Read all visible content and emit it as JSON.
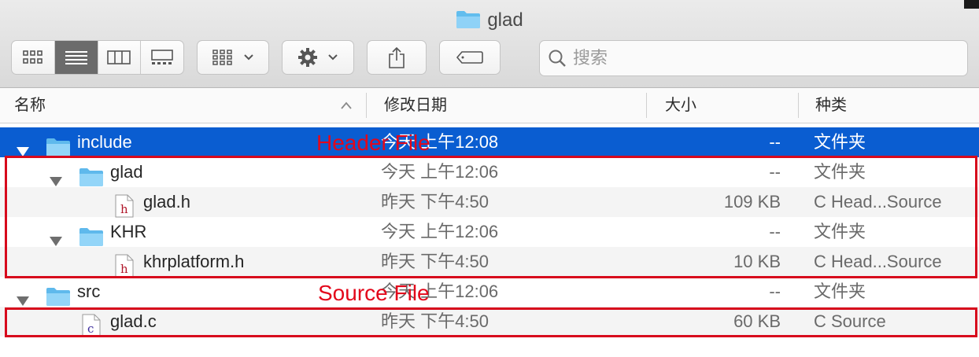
{
  "window": {
    "title": "glad",
    "title_icon": "folder-icon"
  },
  "toolbar": {
    "view_modes": [
      "icon-view",
      "list-view",
      "column-view",
      "gallery-view"
    ],
    "active_view": "list-view",
    "group_icon": "group-by-icon",
    "action_icon": "gear-icon",
    "share_icon": "share-icon",
    "tag_icon": "tag-icon"
  },
  "search": {
    "placeholder": "搜索",
    "value": ""
  },
  "columns": {
    "name": "名称",
    "date": "修改日期",
    "size": "大小",
    "kind": "种类"
  },
  "rows": [
    {
      "name": "include",
      "date": "今天 上午12:08",
      "size": "--",
      "kind": "文件夹",
      "type": "folder",
      "expanded": true,
      "depth": 0,
      "selected": true
    },
    {
      "name": "glad",
      "date": "今天 上午12:06",
      "size": "--",
      "kind": "文件夹",
      "type": "folder",
      "expanded": true,
      "depth": 1
    },
    {
      "name": "glad.h",
      "date": "昨天 下午4:50",
      "size": "109 KB",
      "kind": "C Head...Source",
      "type": "h-file",
      "depth": 2
    },
    {
      "name": "KHR",
      "date": "今天 上午12:06",
      "size": "--",
      "kind": "文件夹",
      "type": "folder",
      "expanded": true,
      "depth": 1
    },
    {
      "name": "khrplatform.h",
      "date": "昨天 下午4:50",
      "size": "10 KB",
      "kind": "C Head...Source",
      "type": "h-file",
      "depth": 2
    },
    {
      "name": "src",
      "date": "今天 上午12:06",
      "size": "--",
      "kind": "文件夹",
      "type": "folder",
      "expanded": true,
      "depth": 0
    },
    {
      "name": "glad.c",
      "date": "昨天 下午4:50",
      "size": "60 KB",
      "kind": "C Source",
      "type": "c-file",
      "depth": 1
    }
  ],
  "annotations": {
    "header": "Header File",
    "source": "Source File",
    "color": "#e3081b"
  },
  "colors": {
    "selection": "#0a5dd1",
    "folder": "#5fb9ec",
    "annotation_box": "#d7091c"
  }
}
